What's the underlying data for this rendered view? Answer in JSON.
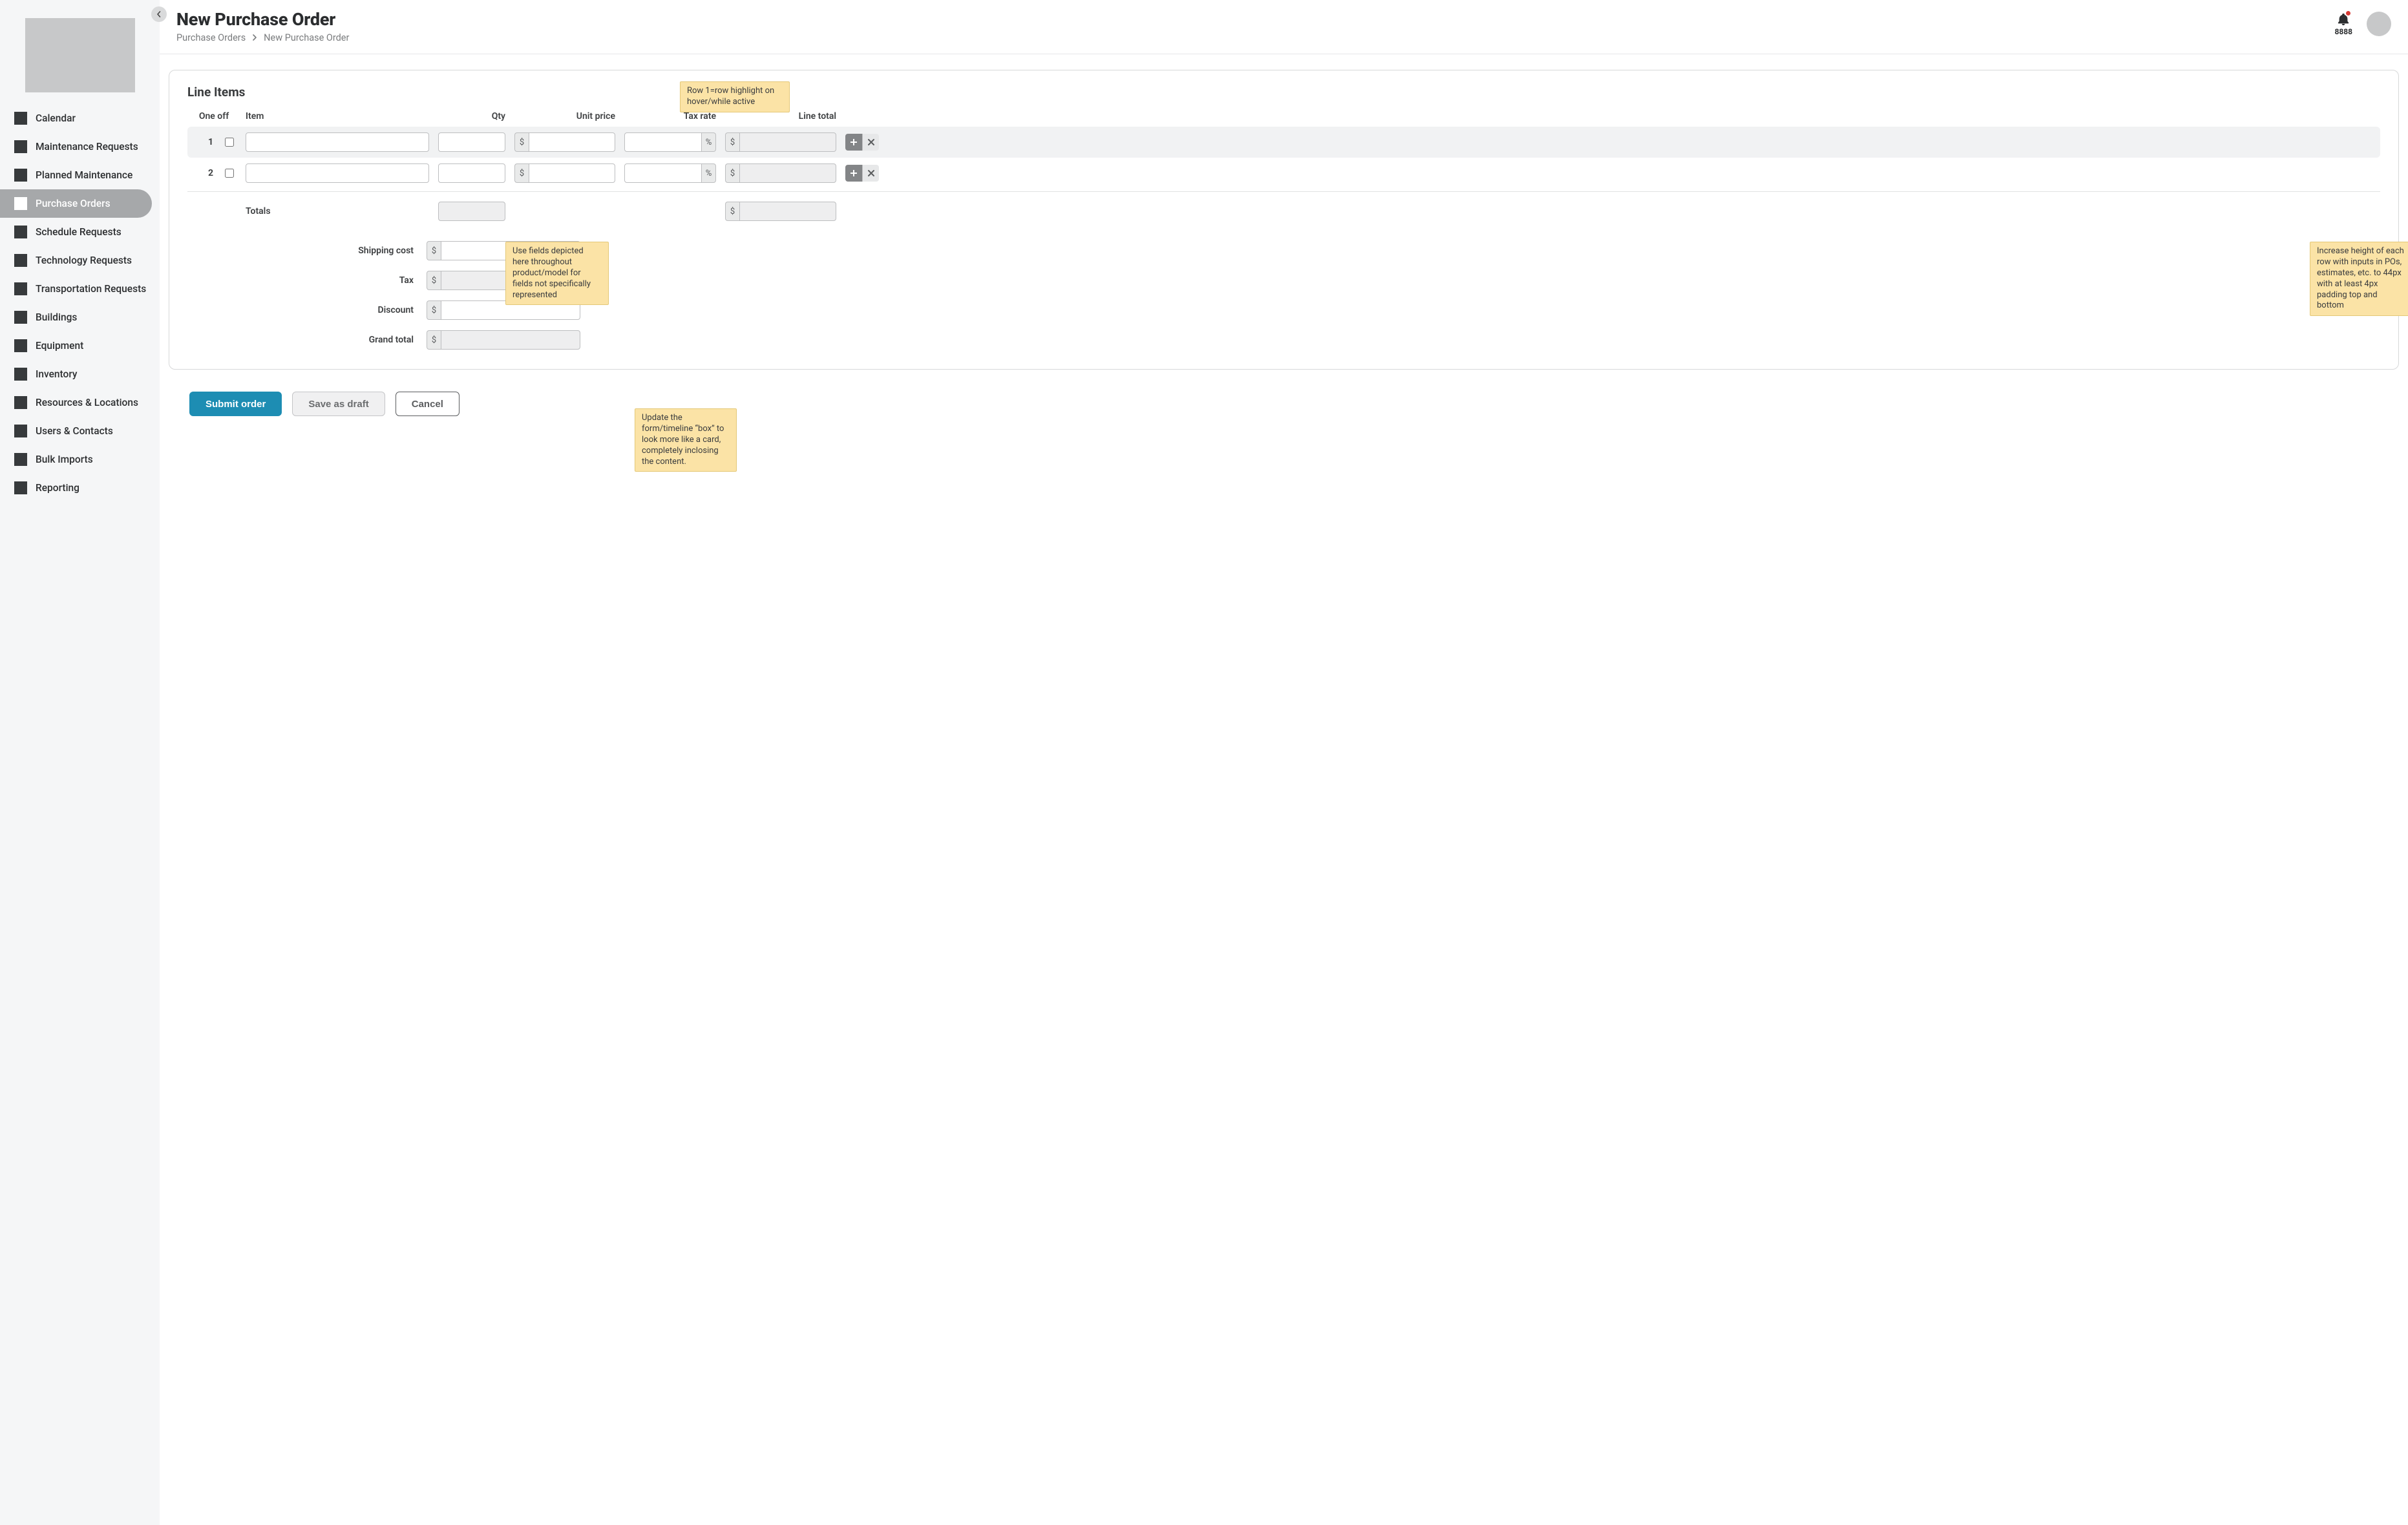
{
  "sidebar": {
    "items": [
      {
        "label": "Calendar"
      },
      {
        "label": "Maintenance Requests"
      },
      {
        "label": "Planned Maintenance"
      },
      {
        "label": "Purchase Orders",
        "active": true
      },
      {
        "label": "Schedule Requests"
      },
      {
        "label": "Technology Requests"
      },
      {
        "label": "Transportation Requests"
      },
      {
        "label": "Buildings"
      },
      {
        "label": "Equipment"
      },
      {
        "label": "Inventory"
      },
      {
        "label": "Resources & Locations"
      },
      {
        "label": "Users & Contacts"
      },
      {
        "label": "Bulk Imports"
      },
      {
        "label": "Reporting"
      }
    ]
  },
  "header": {
    "title": "New Purchase Order",
    "breadcrumb": {
      "root": "Purchase Orders",
      "current": "New Purchase Order"
    },
    "notifications_count": "8888"
  },
  "line_items": {
    "section_title": "Line Items",
    "columns": {
      "one_off": "One off",
      "item": "Item",
      "qty": "Qty",
      "unit_price": "Unit price",
      "tax_rate": "Tax rate",
      "line_total": "Line total"
    },
    "rows": [
      {
        "idx": "1",
        "one_off": false,
        "item": "",
        "qty": "",
        "unit_price": "",
        "tax_rate": "",
        "line_total": "",
        "active": true
      },
      {
        "idx": "2",
        "one_off": false,
        "item": "",
        "qty": "",
        "unit_price": "",
        "tax_rate": "",
        "line_total": "",
        "active": false
      }
    ],
    "totals_label": "Totals",
    "totals_qty": "",
    "totals_line": "",
    "currency_symbol": "$",
    "percent_symbol": "%"
  },
  "summary": {
    "shipping_label": "Shipping cost",
    "shipping_value": "",
    "tax_label": "Tax",
    "tax_value": "",
    "discount_label": "Discount",
    "discount_value": "",
    "grand_total_label": "Grand total",
    "grand_total_value": ""
  },
  "actions": {
    "submit": "Submit order",
    "draft": "Save as draft",
    "cancel": "Cancel"
  },
  "notes": {
    "n1": "Row 1=row highlight on hover/while active",
    "n2": "Use fields depicted here throughout product/model for fields not specifically represented",
    "n3": "Increase height of each row with inputs in POs, estimates, etc. to 44px with at least 4px padding top and bottom",
    "n4": "Update the form/timeline “box” to look more like a card, completely inclosing the content."
  }
}
